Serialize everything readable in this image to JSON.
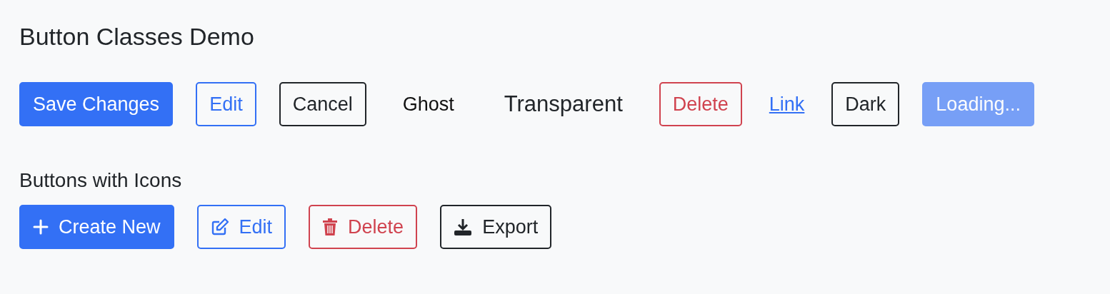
{
  "title": "Button Classes Demo",
  "buttons": [
    {
      "label": "Save Changes",
      "kind": "primary"
    },
    {
      "label": "Edit",
      "kind": "outline-primary"
    },
    {
      "label": "Cancel",
      "kind": "outline-dark"
    },
    {
      "label": "Ghost",
      "kind": "ghost"
    },
    {
      "label": "Transparent",
      "kind": "transparent"
    },
    {
      "label": "Delete",
      "kind": "outline-danger"
    },
    {
      "label": "Link",
      "kind": "link"
    },
    {
      "label": "Dark",
      "kind": "outline-dark"
    },
    {
      "label": "Loading...",
      "kind": "loading",
      "disabled": true
    }
  ],
  "icon_section": {
    "heading": "Buttons with Icons",
    "buttons": [
      {
        "label": "Create New",
        "kind": "primary"
      },
      {
        "label": "Edit",
        "kind": "outline-primary"
      },
      {
        "label": "Delete",
        "kind": "outline-danger"
      },
      {
        "label": "Export",
        "kind": "outline-dark"
      }
    ]
  }
}
